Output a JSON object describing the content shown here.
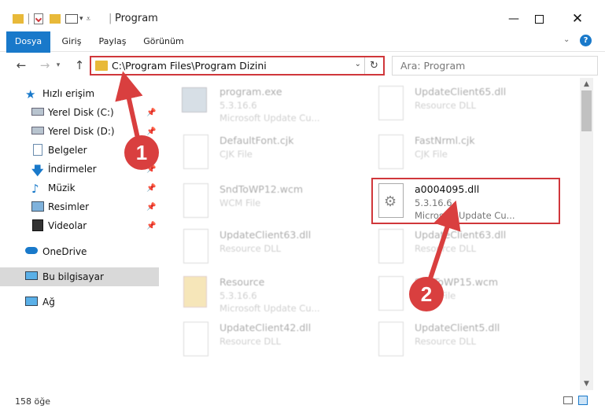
{
  "window": {
    "title": "Program",
    "controls": [
      "minimize",
      "maximize",
      "close"
    ]
  },
  "ribbon": {
    "tabs": [
      "Dosya",
      "Giriş",
      "Paylaş",
      "Görünüm"
    ]
  },
  "address_bar": {
    "path": "C:\\Program Files\\Program Dizini",
    "search_placeholder": "Ara: Program"
  },
  "sidebar": {
    "items": [
      {
        "label": "Hızlı erişim",
        "icon": "star-icon"
      },
      {
        "label": "Yerel Disk (C:)",
        "icon": "drive-icon",
        "pinned": true
      },
      {
        "label": "Yerel Disk (D:)",
        "icon": "drive-icon",
        "pinned": true
      },
      {
        "label": "Belgeler",
        "icon": "document-icon",
        "pinned": true
      },
      {
        "label": "İndirmeler",
        "icon": "download-icon",
        "pinned": true
      },
      {
        "label": "Müzik",
        "icon": "music-icon",
        "pinned": true
      },
      {
        "label": "Resimler",
        "icon": "picture-icon",
        "pinned": true
      },
      {
        "label": "Videolar",
        "icon": "video-icon",
        "pinned": true
      },
      {
        "label": "OneDrive",
        "icon": "cloud-icon"
      },
      {
        "label": "Bu bilgisayar",
        "icon": "computer-icon",
        "selected": true
      },
      {
        "label": "Ağ",
        "icon": "network-icon"
      }
    ]
  },
  "files": [
    {
      "name": "program.exe",
      "line1": "5.3.16.6",
      "line2": "Microsoft Update Cu..."
    },
    {
      "name": "UpdateClient65.dll",
      "line1": "Resource DLL",
      "line2": ""
    },
    {
      "name": "DefaultFont.cjk",
      "line1": "CJK File",
      "line2": ""
    },
    {
      "name": "FastNrml.cjk",
      "line1": "CJK File",
      "line2": ""
    },
    {
      "name": "SndToWP12.wcm",
      "line1": "WCM File",
      "line2": ""
    },
    {
      "name": "a0004095.dll",
      "line1": "5.3.16.6",
      "line2": "Microsoft Update Cu...",
      "highlighted": true
    },
    {
      "name": "UpdateClient63.dll",
      "line1": "Resource DLL",
      "line2": ""
    },
    {
      "name": "UpdateClient63.dll",
      "line1": "Resource DLL",
      "line2": ""
    },
    {
      "name": "Resource",
      "line1": "5.3.16.6",
      "line2": "Microsoft Update Cu..."
    },
    {
      "name": "SndToWP15.wcm",
      "line1": "WCM File",
      "line2": ""
    },
    {
      "name": "UpdateClient42.dll",
      "line1": "Resource DLL",
      "line2": ""
    },
    {
      "name": "UpdateClient5.dll",
      "line1": "Resource DLL",
      "line2": ""
    }
  ],
  "status": {
    "item_count": "158 öğe"
  },
  "annotations": {
    "step1": "1",
    "step2": "2",
    "color": "#d93f3f"
  }
}
